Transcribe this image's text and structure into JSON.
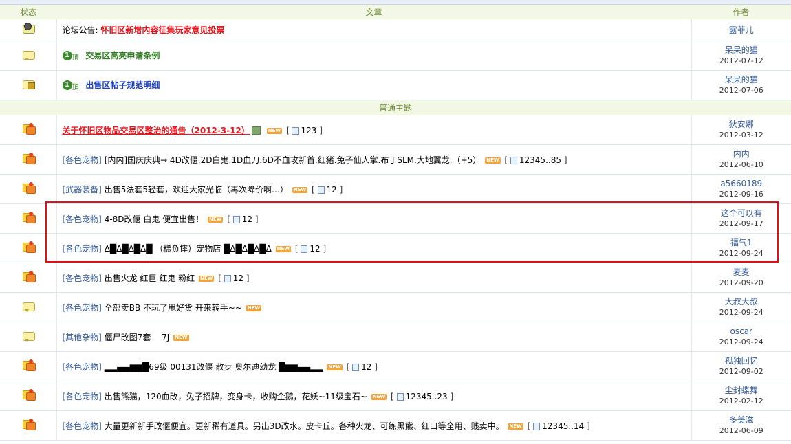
{
  "header": {
    "status": "状态",
    "article": "文章",
    "author": "作者"
  },
  "section_label": "普通主题",
  "announcement": {
    "prefix": "论坛公告:",
    "title": "怀旧区新增内容征集玩家意见投票",
    "author": "露菲儿"
  },
  "pinned": [
    {
      "title": "交易区高亮申请条例",
      "author": "呆呆的猫",
      "date": "2012-07-12",
      "color": "#2e7d1e",
      "locked": false
    },
    {
      "title": "出售区帖子规范明细",
      "author": "呆呆的猫",
      "date": "2012-07-06",
      "color": "#1b3fc6",
      "locked": true
    }
  ],
  "pin_badge": {
    "num": "1",
    "text": "頂"
  },
  "new_label": "NEW",
  "threads": [
    {
      "category": "",
      "title": "关于怀旧区物品交易区整治的通告（2012-3-12）",
      "pages": [
        "1",
        "2",
        "3"
      ],
      "author": "狄安娜",
      "date": "2012-03-12",
      "icon": "hot"
    },
    {
      "category": "[各色宠物]",
      "title": "[内内]国庆庆典→ 4D改偃.2D白鬼.1D血刀.6D不血攻新首.红猪.兔子仙人掌.布丁SLM.大地翼龙.（+5）",
      "pages": [
        "1",
        "2",
        "3",
        "4",
        "5",
        "..",
        "85"
      ],
      "author": "内内",
      "date": "2012-06-10",
      "icon": "hot"
    },
    {
      "category": "[武器装备]",
      "title": "出售5法套5轻套，欢迎大家光临（再次降价啊…）",
      "pages": [
        "1",
        "2"
      ],
      "author": "a5660189",
      "date": "2012-09-16",
      "icon": "hot"
    },
    {
      "category": "[各色宠物]",
      "title": "4-8D改偃 白鬼 便宜出售！",
      "pages": [
        "1",
        "2"
      ],
      "author": "这个可以有",
      "date": "2012-09-17",
      "icon": "hot"
    },
    {
      "category": "[各色宠物]",
      "title": "Δ█Δ█Δ█Δ█ （糕负摔）宠物店 █Δ█Δ█Δ█Δ",
      "pages": [
        "1",
        "2"
      ],
      "author": "福气1",
      "date": "2012-09-24",
      "icon": "hot"
    },
    {
      "category": "[各色宠物]",
      "title": "出售火龙 红巨 红鬼 粉红",
      "pages": [
        "1",
        "2"
      ],
      "author": "麦麦",
      "date": "2012-09-20",
      "icon": "hot"
    },
    {
      "category": "[各色宠物]",
      "title": "全部卖BB 不玩了甩好货 开来转手~~",
      "pages": [],
      "author": "大叔大叔",
      "date": "2012-09-24",
      "icon": "norm"
    },
    {
      "category": "[其他杂物]",
      "title": "僵尸改图7套　 7J",
      "pages": [],
      "author": "oscar",
      "date": "2012-09-24",
      "icon": "norm"
    },
    {
      "category": "[各色宠物]",
      "title": "▂▂▄▄▆▆█69级 00131改偃 散步 奥尔迪幼龙 █▆▆▄▄▂▂",
      "pages": [
        "1",
        "2"
      ],
      "author": "孤独回忆",
      "date": "2012-09-02",
      "icon": "hot"
    },
    {
      "category": "[各色宠物]",
      "title": "出售熊猫，120血改，兔子招牌，变身卡，收购企鹅，花妖~11级宝石~",
      "pages": [
        "1",
        "2",
        "3",
        "4",
        "5",
        "..",
        "23"
      ],
      "author": "尘封蝶舞",
      "date": "2012-02-12",
      "icon": "hot"
    },
    {
      "category": "[各色宠物]",
      "title": "大量更新新手改偃便宜。更新稀有道具。另出3D改水。皮卡丘。各种火龙、可练黑熊、红口等全用、贱卖中。",
      "pages": [
        "1",
        "2",
        "3",
        "4",
        "5",
        "..",
        "14"
      ],
      "author": "多美滋",
      "date": "2012-06-09",
      "icon": "hot"
    }
  ]
}
